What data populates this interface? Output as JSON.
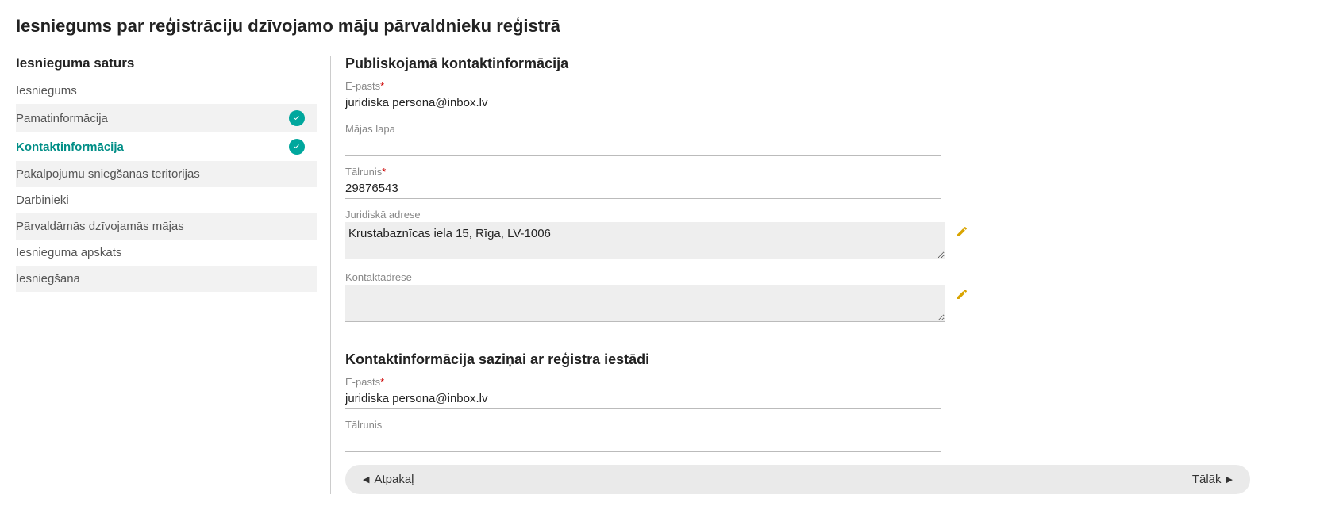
{
  "page_title": "Iesniegums par reģistrāciju dzīvojamo māju pārvaldnieku reģistrā",
  "sidebar": {
    "heading": "Iesnieguma saturs",
    "items": [
      {
        "label": "Iesniegums",
        "checked": false,
        "active": false,
        "alt": false
      },
      {
        "label": "Pamatinformācija",
        "checked": true,
        "active": false,
        "alt": true
      },
      {
        "label": "Kontaktinformācija",
        "checked": true,
        "active": true,
        "alt": false
      },
      {
        "label": "Pakalpojumu sniegšanas teritorijas",
        "checked": false,
        "active": false,
        "alt": true
      },
      {
        "label": "Darbinieki",
        "checked": false,
        "active": false,
        "alt": false
      },
      {
        "label": "Pārvaldāmās dzīvojamās mājas",
        "checked": false,
        "active": false,
        "alt": true
      },
      {
        "label": "Iesnieguma apskats",
        "checked": false,
        "active": false,
        "alt": false
      },
      {
        "label": "Iesniegšana",
        "checked": false,
        "active": false,
        "alt": true
      }
    ]
  },
  "section1": {
    "heading": "Publiskojamā kontaktinformācija",
    "email_label": "E-pasts",
    "email_value": "juridiska persona@inbox.lv",
    "homepage_label": "Mājas lapa",
    "homepage_value": "",
    "phone_label": "Tālrunis",
    "phone_value": "29876543",
    "legal_addr_label": "Juridiskā adrese",
    "legal_addr_value": "Krustabaznīcas iela 15, Rīga, LV-1006",
    "contact_addr_label": "Kontaktadrese",
    "contact_addr_value": ""
  },
  "section2": {
    "heading": "Kontaktinformācija saziņai ar reģistra iestādi",
    "email_label": "E-pasts",
    "email_value": "juridiska persona@inbox.lv",
    "phone_label": "Tālrunis",
    "phone_value": ""
  },
  "buttons": {
    "back": "Atpakaļ",
    "next": "Tālāk"
  }
}
